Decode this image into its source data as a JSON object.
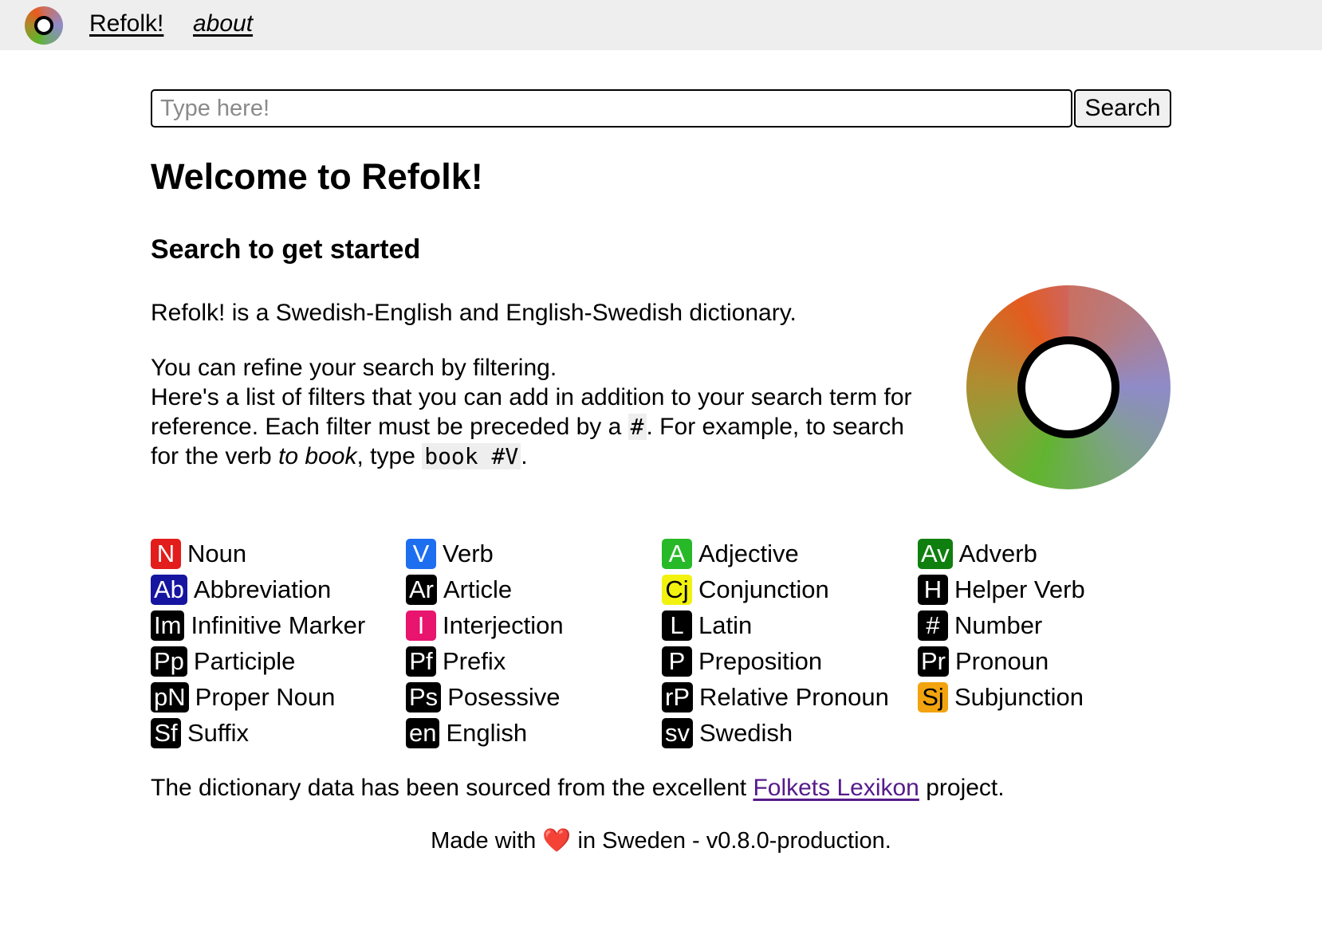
{
  "nav": {
    "home_label": "Refolk!",
    "about_label": "about"
  },
  "search": {
    "placeholder": "Type here!",
    "value": "",
    "button_label": "Search"
  },
  "main": {
    "title": "Welcome to Refolk!",
    "subtitle": "Search to get started",
    "intro": "Refolk! is a Swedish-English and English-Swedish dictionary.",
    "refine_line1": "You can refine your search by filtering.",
    "refine_line2_a": "Here's a list of filters that you can add in addition to your search term for reference. Each filter must be preceded by a ",
    "refine_hash": "#",
    "refine_line2_b": ". For example, to search for the verb ",
    "refine_verb": "to book",
    "refine_line2_c": ", type ",
    "refine_example": "book #V",
    "refine_end": "."
  },
  "filters": [
    {
      "tag": "N",
      "label": "Noun",
      "color": "#e31c1c",
      "text": "#ffffff"
    },
    {
      "tag": "V",
      "label": "Verb",
      "color": "#1e6ef0",
      "text": "#ffffff"
    },
    {
      "tag": "A",
      "label": "Adjective",
      "color": "#28b928",
      "text": "#ffffff"
    },
    {
      "tag": "Av",
      "label": "Adverb",
      "color": "#0f7f0f",
      "text": "#ffffff"
    },
    {
      "tag": "Ab",
      "label": "Abbreviation",
      "color": "#1515a0",
      "text": "#ffffff"
    },
    {
      "tag": "Ar",
      "label": "Article",
      "color": "#000000",
      "text": "#ffffff"
    },
    {
      "tag": "Cj",
      "label": "Conjunction",
      "color": "#f2f20f",
      "text": "#000000"
    },
    {
      "tag": "H",
      "label": "Helper Verb",
      "color": "#000000",
      "text": "#ffffff"
    },
    {
      "tag": "Im",
      "label": "Infinitive Marker",
      "color": "#000000",
      "text": "#ffffff"
    },
    {
      "tag": "I",
      "label": "Interjection",
      "color": "#e8146e",
      "text": "#ffffff"
    },
    {
      "tag": "L",
      "label": "Latin",
      "color": "#000000",
      "text": "#ffffff"
    },
    {
      "tag": "#",
      "label": "Number",
      "color": "#000000",
      "text": "#ffffff"
    },
    {
      "tag": "Pp",
      "label": "Participle",
      "color": "#000000",
      "text": "#ffffff"
    },
    {
      "tag": "Pf",
      "label": "Prefix",
      "color": "#000000",
      "text": "#ffffff"
    },
    {
      "tag": "P",
      "label": "Preposition",
      "color": "#000000",
      "text": "#ffffff"
    },
    {
      "tag": "Pr",
      "label": "Pronoun",
      "color": "#000000",
      "text": "#ffffff"
    },
    {
      "tag": "pN",
      "label": "Proper Noun",
      "color": "#000000",
      "text": "#ffffff"
    },
    {
      "tag": "Ps",
      "label": "Posessive",
      "color": "#000000",
      "text": "#ffffff"
    },
    {
      "tag": "rP",
      "label": "Relative Pronoun",
      "color": "#000000",
      "text": "#ffffff"
    },
    {
      "tag": "Sj",
      "label": "Subjunction",
      "color": "#f2a30f",
      "text": "#000000"
    },
    {
      "tag": "Sf",
      "label": "Suffix",
      "color": "#000000",
      "text": "#ffffff"
    },
    {
      "tag": "en",
      "label": "English",
      "color": "#000000",
      "text": "#ffffff"
    },
    {
      "tag": "sv",
      "label": "Swedish",
      "color": "#000000",
      "text": "#ffffff"
    }
  ],
  "footer": {
    "source_before": "The dictionary data has been sourced from the excellent ",
    "source_link": "Folkets Lexikon",
    "source_after": " project.",
    "made_before": "Made with ",
    "heart": "❤️",
    "made_after": " in Sweden - v0.8.0-production."
  }
}
